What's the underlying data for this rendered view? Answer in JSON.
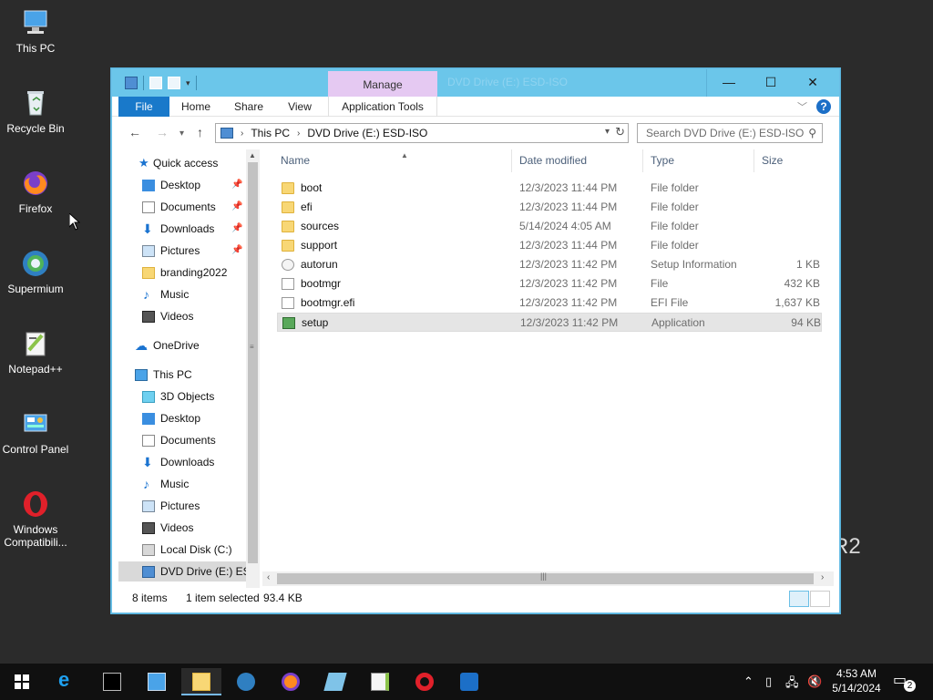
{
  "desktop": {
    "icons": [
      {
        "label": "This PC"
      },
      {
        "label": "Recycle Bin"
      },
      {
        "label": "Firefox"
      },
      {
        "label": "Supermium"
      },
      {
        "label": "Notepad++"
      },
      {
        "label": "Control Panel"
      },
      {
        "label": "Windows Compatibili..."
      }
    ],
    "wallpaper_text": "R2"
  },
  "window": {
    "title": "DVD Drive (E:) ESD-ISO",
    "manage_tab": "Manage",
    "ribbon_tabs": {
      "file": "File",
      "home": "Home",
      "share": "Share",
      "view": "View",
      "app_tools": "Application Tools"
    },
    "address": {
      "crumbs": [
        "This PC",
        "DVD Drive (E:) ESD-ISO"
      ]
    },
    "search": {
      "placeholder": "Search DVD Drive (E:) ESD-ISO"
    },
    "nav_pane": {
      "quick_access": "Quick access",
      "quick_items": [
        "Desktop",
        "Documents",
        "Downloads",
        "Pictures",
        "branding2022",
        "Music",
        "Videos"
      ],
      "onedrive": "OneDrive",
      "this_pc": "This PC",
      "pc_items": [
        "3D Objects",
        "Desktop",
        "Documents",
        "Downloads",
        "Music",
        "Pictures",
        "Videos",
        "Local Disk (C:)",
        "DVD Drive (E:) ESD-ISO"
      ]
    },
    "columns": {
      "name": "Name",
      "date": "Date modified",
      "type": "Type",
      "size": "Size"
    },
    "files": [
      {
        "name": "boot",
        "date": "12/3/2023 11:44 PM",
        "type": "File folder",
        "size": "",
        "icon": "folder-icon"
      },
      {
        "name": "efi",
        "date": "12/3/2023 11:44 PM",
        "type": "File folder",
        "size": "",
        "icon": "folder-icon"
      },
      {
        "name": "sources",
        "date": "5/14/2024 4:05 AM",
        "type": "File folder",
        "size": "",
        "icon": "folder-icon"
      },
      {
        "name": "support",
        "date": "12/3/2023 11:44 PM",
        "type": "File folder",
        "size": "",
        "icon": "folder-icon"
      },
      {
        "name": "autorun",
        "date": "12/3/2023 11:42 PM",
        "type": "Setup Information",
        "size": "1 KB",
        "icon": "setup-info-icon"
      },
      {
        "name": "bootmgr",
        "date": "12/3/2023 11:42 PM",
        "type": "File",
        "size": "432 KB",
        "icon": "file-icon"
      },
      {
        "name": "bootmgr.efi",
        "date": "12/3/2023 11:42 PM",
        "type": "EFI File",
        "size": "1,637 KB",
        "icon": "file-icon"
      },
      {
        "name": "setup",
        "date": "12/3/2023 11:42 PM",
        "type": "Application",
        "size": "94 KB",
        "icon": "application-icon"
      }
    ],
    "status": {
      "count": "8 items",
      "selection": "1 item selected",
      "size": "93.4 KB"
    }
  },
  "taskbar": {
    "clock_time": "4:53 AM",
    "clock_date": "5/14/2024",
    "notification_count": "2"
  },
  "colors": {
    "titlebar": "#6bc6ea",
    "manage_tab": "#e5c9f2",
    "file_tab": "#1979ca",
    "desktop": "#2b2b2b",
    "taskbar": "#101010"
  }
}
